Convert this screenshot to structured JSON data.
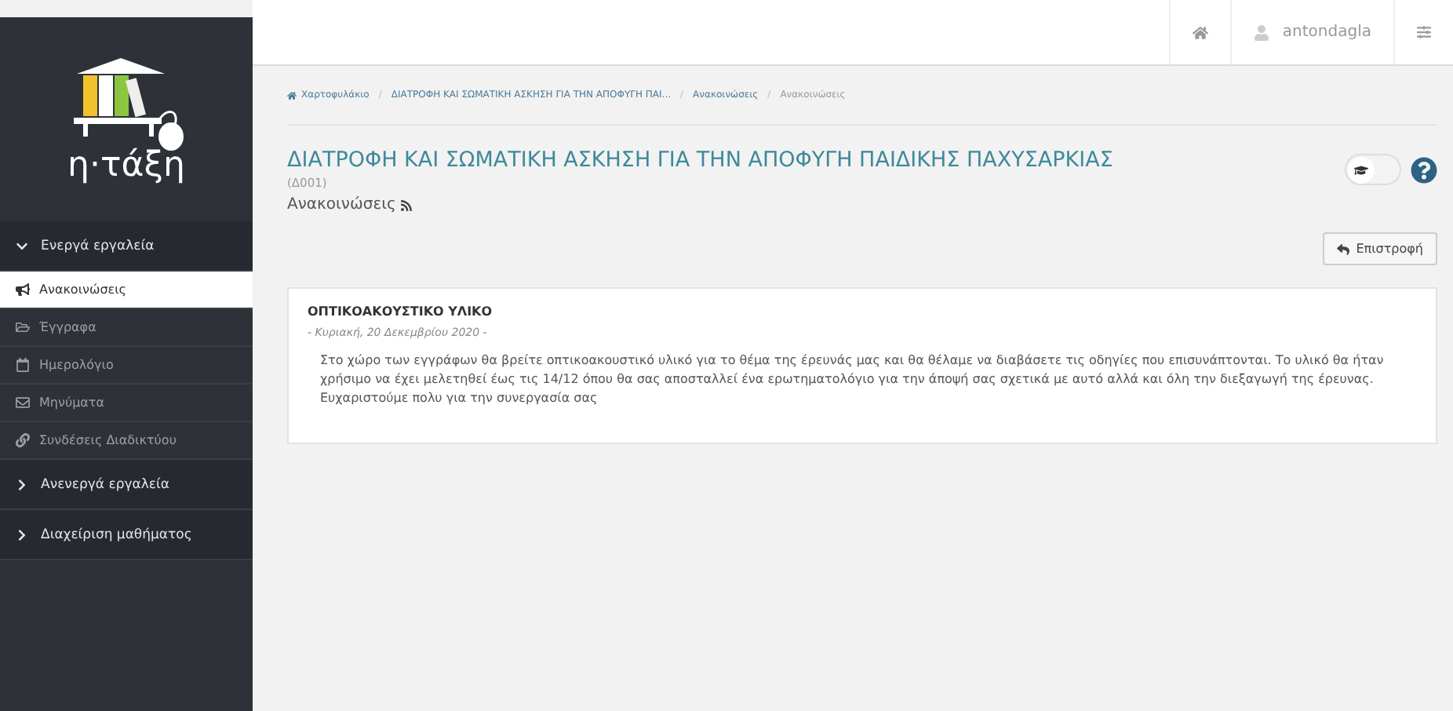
{
  "logo": {
    "text": "η·τάξη"
  },
  "sidebar": {
    "sections": [
      {
        "label": "Ενεργά εργαλεία",
        "expanded": true,
        "items": [
          {
            "label": "Ανακοινώσεις",
            "kind": "megaphone",
            "selected": true
          },
          {
            "label": "Έγγραφα",
            "kind": "folder",
            "selected": false
          },
          {
            "label": "Ημερολόγιο",
            "kind": "calendar",
            "selected": false
          },
          {
            "label": "Μηνύματα",
            "kind": "envelope",
            "selected": false
          },
          {
            "label": "Συνδέσεις Διαδικτύου",
            "kind": "link",
            "selected": false
          }
        ]
      },
      {
        "label": "Ανενεργά εργαλεία",
        "expanded": false
      },
      {
        "label": "Διαχείριση μαθήματος",
        "expanded": false
      }
    ]
  },
  "topbar": {
    "user": "antondagla"
  },
  "breadcrumb_separator": "/",
  "breadcrumb": [
    "Χαρτοφυλάκιο",
    "ΔΙΑΤΡΟΦΗ ΚΑΙ ΣΩΜΑΤΙΚΗ ΑΣΚΗΣΗ ΓΙΑ ΤΗΝ ΑΠΟΦΥΓΗ ΠΑΙ...",
    "Ανακοινώσεις",
    "Ανακοινώσεις"
  ],
  "course": {
    "title": "ΔΙΑΤΡΟΦΗ ΚΑΙ ΣΩΜΑΤΙΚΗ ΑΣΚΗΣΗ ΓΙΑ ΤΗΝ ΑΠΟΦΥΓΗ ΠΑΙΔΙΚΗΣ ΠΑΧΥΣΑΡΚΙΑΣ",
    "code": "(Δ001)",
    "section": "Ανακοινώσεις",
    "student_view": false
  },
  "back_button": "Επιστροφή",
  "announcement": {
    "title": "ΟΠΤΙΚΟΑΚΟΥΣΤΙΚΟ ΥΛΙΚΟ",
    "date": "- Κυριακή, 20 Δεκεμβρίου 2020 -",
    "body": "Στο χώρο των εγγράφων θα βρείτε οπτικοακουστικό υλικό για το θέμα της έρευνάς μας και θα θέλαμε να διαβάσετε τις οδηγίες που επισυνάπτονται. Το υλικό θα ήταν χρήσιμο να έχει μελετηθεί έως τις 14/12 όπου θα σας αποσταλλεί ένα ερωτηματολόγιο για την άποψή σας σχετικά με αυτό αλλά και όλη την διεξαγωγή της έρευνας. Ευχαριστούμε πολυ για την συνεργασία σας"
  }
}
